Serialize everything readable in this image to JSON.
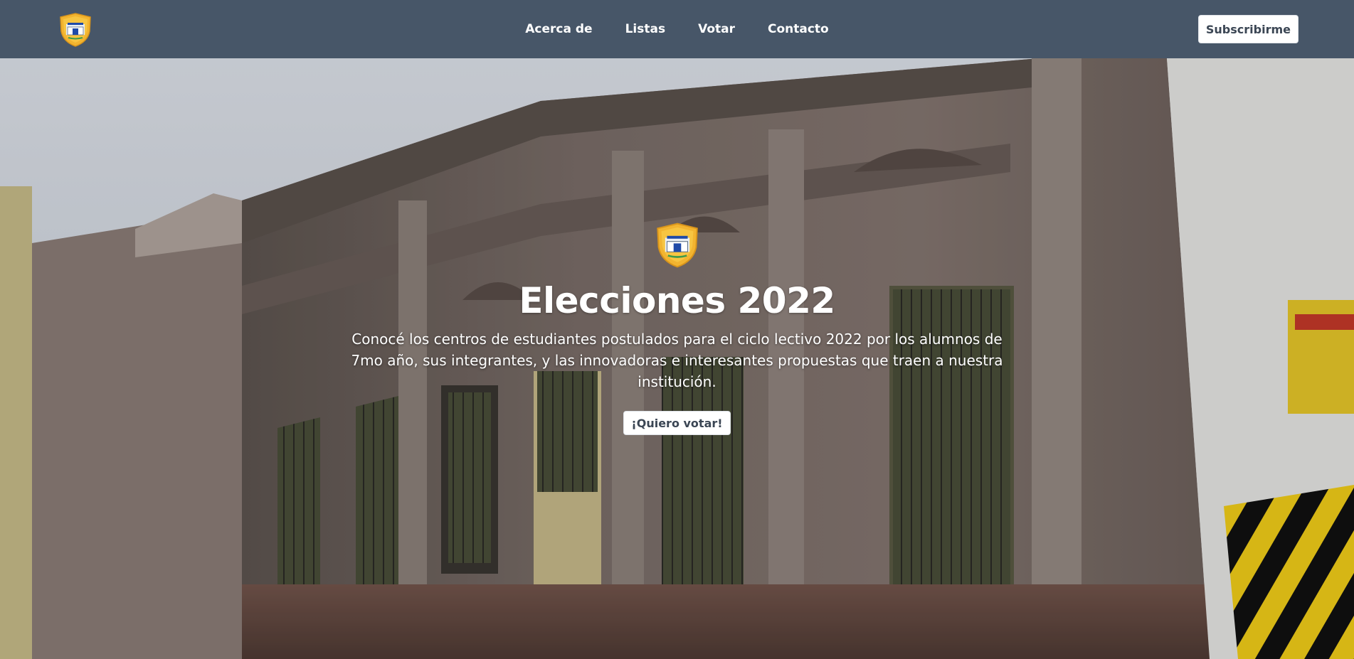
{
  "navbar": {
    "logo_icon": "school-crest-icon",
    "links": [
      {
        "label": "Acerca de"
      },
      {
        "label": "Listas"
      },
      {
        "label": "Votar"
      },
      {
        "label": "Contacto"
      }
    ],
    "subscribe_label": "Subscribirme",
    "background": "#475668"
  },
  "hero": {
    "logo_icon": "school-crest-icon",
    "title": "Elecciones 2022",
    "description": "Conocé los centros de estudiantes postulados para el ciclo lectivo 2022 por los alumnos de 7mo año, sus integrantes, y las innovadoras e interesantes propuestas que traen a nuestra institución.",
    "cta_label": "¡Quiero votar!",
    "background_image": "school-building-facade"
  },
  "colors": {
    "button_text": "#3b4654",
    "crest_gold": "#f2b430"
  }
}
